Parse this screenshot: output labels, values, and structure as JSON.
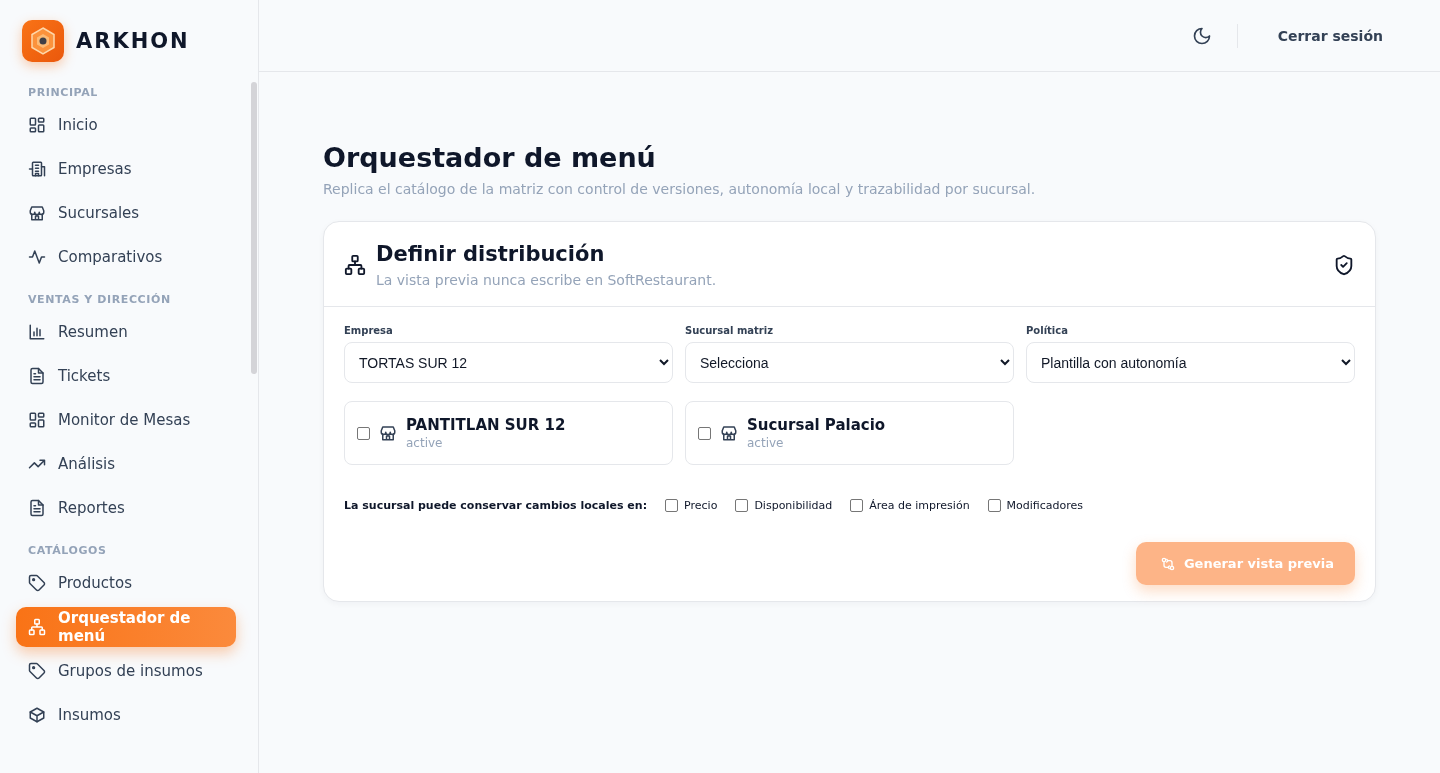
{
  "brand": {
    "name": "ARKHON"
  },
  "sidebar": {
    "sections": [
      {
        "title": "PRINCIPAL",
        "items": [
          {
            "label": "Inicio",
            "selected": false
          },
          {
            "label": "Empresas",
            "selected": false
          },
          {
            "label": "Sucursales",
            "selected": false
          },
          {
            "label": "Comparativos",
            "selected": false
          }
        ]
      },
      {
        "title": "VENTAS Y DIRECCIÓN",
        "items": [
          {
            "label": "Resumen",
            "selected": false
          },
          {
            "label": "Tickets",
            "selected": false
          },
          {
            "label": "Monitor de Mesas",
            "selected": false
          },
          {
            "label": "Análisis",
            "selected": false
          },
          {
            "label": "Reportes",
            "selected": false
          }
        ]
      },
      {
        "title": "CATÁLOGOS",
        "items": [
          {
            "label": "Productos",
            "selected": false
          },
          {
            "label": "Orquestador de menú",
            "selected": true
          },
          {
            "label": "Grupos de insumos",
            "selected": false
          },
          {
            "label": "Insumos",
            "selected": false
          }
        ]
      }
    ]
  },
  "topbar": {
    "logout": "Cerrar sesión"
  },
  "page": {
    "title": "Orquestador de menú",
    "subtitle": "Replica el catálogo de la matriz con control de versiones, autonomía local y trazabilidad por sucursal."
  },
  "card": {
    "title": "Definir distribución",
    "subtitle": "La vista previa nunca escribe en SoftRestaurant.",
    "fields": [
      {
        "label": "Empresa",
        "value": "TORTAS SUR 12"
      },
      {
        "label": "Sucursal matriz",
        "value": "Selecciona"
      },
      {
        "label": "Política",
        "value": "Plantilla con autonomía"
      }
    ],
    "branches": [
      {
        "name": "PANTITLAN SUR 12",
        "status": "active",
        "checked": false
      },
      {
        "name": "Sucursal Palacio",
        "status": "active",
        "checked": false
      }
    ],
    "local_changes": {
      "label": "La sucursal puede conservar cambios locales en:",
      "options": [
        {
          "label": "Precio",
          "checked": false
        },
        {
          "label": "Disponibilidad",
          "checked": false
        },
        {
          "label": "Área de impresión",
          "checked": false
        },
        {
          "label": "Modificadores",
          "checked": false
        }
      ]
    },
    "button": {
      "label": "Generar vista previa",
      "disabled": true
    }
  }
}
